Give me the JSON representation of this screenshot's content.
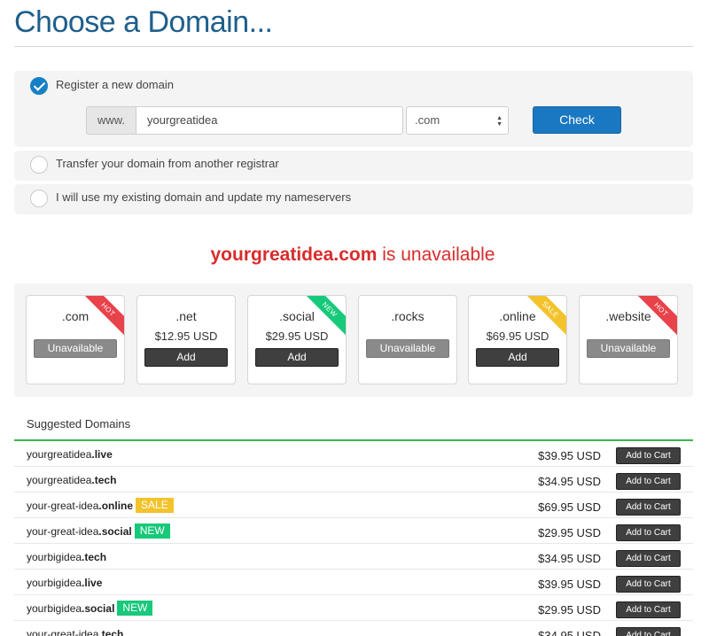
{
  "page": {
    "title": "Choose a Domain..."
  },
  "options": {
    "register": {
      "label": "Register a new domain",
      "checked": true
    },
    "transfer": {
      "label": "Transfer your domain from another registrar",
      "checked": false
    },
    "existing": {
      "label": "I will use my existing domain and update my nameservers",
      "checked": false
    }
  },
  "search": {
    "prefix": "www.",
    "value": "yourgreatidea",
    "tld_selected": ".com",
    "check_label": "Check"
  },
  "result": {
    "domain": "yourgreatidea.com",
    "status": "is unavailable",
    "color": "#d82c2c"
  },
  "tld_cards": [
    {
      "tld": ".com",
      "price": "",
      "button": "Unavailable",
      "button_type": "unavailable",
      "ribbon": "HOT"
    },
    {
      "tld": ".net",
      "price": "$12.95 USD",
      "button": "Add",
      "button_type": "add",
      "ribbon": ""
    },
    {
      "tld": ".social",
      "price": "$29.95 USD",
      "button": "Add",
      "button_type": "add",
      "ribbon": "NEW"
    },
    {
      "tld": ".rocks",
      "price": "",
      "button": "Unavailable",
      "button_type": "unavailable",
      "ribbon": ""
    },
    {
      "tld": ".online",
      "price": "$69.95 USD",
      "button": "Add",
      "button_type": "add",
      "ribbon": "SALE"
    },
    {
      "tld": ".website",
      "price": "",
      "button": "Unavailable",
      "button_type": "unavailable",
      "ribbon": "HOT"
    }
  ],
  "suggested": {
    "heading": "Suggested Domains",
    "add_label": "Add to Cart",
    "items": [
      {
        "sld": "yourgreatidea",
        "tld": ".live",
        "price": "$39.95 USD",
        "tag": ""
      },
      {
        "sld": "yourgreatidea",
        "tld": ".tech",
        "price": "$34.95 USD",
        "tag": ""
      },
      {
        "sld": "your-great-idea",
        "tld": ".online",
        "price": "$69.95 USD",
        "tag": "SALE"
      },
      {
        "sld": "your-great-idea",
        "tld": ".social",
        "price": "$29.95 USD",
        "tag": "NEW"
      },
      {
        "sld": "yourbigidea",
        "tld": ".tech",
        "price": "$34.95 USD",
        "tag": ""
      },
      {
        "sld": "yourbigidea",
        "tld": ".live",
        "price": "$39.95 USD",
        "tag": ""
      },
      {
        "sld": "yourbigidea",
        "tld": ".social",
        "price": "$29.95 USD",
        "tag": "NEW"
      },
      {
        "sld": "your-great-idea",
        "tld": ".tech",
        "price": "$34.95 USD",
        "tag": ""
      }
    ]
  },
  "colors": {
    "title": "#1e5f8c",
    "primary": "#1a78c2",
    "hot": "#e8424a",
    "new": "#17c97a",
    "sale": "#f3c32c",
    "accent_rule": "#3bb54a"
  },
  "icons": {
    "radio_checked": "checkmark-icon",
    "select_arrows": "up-down-arrows-icon"
  }
}
